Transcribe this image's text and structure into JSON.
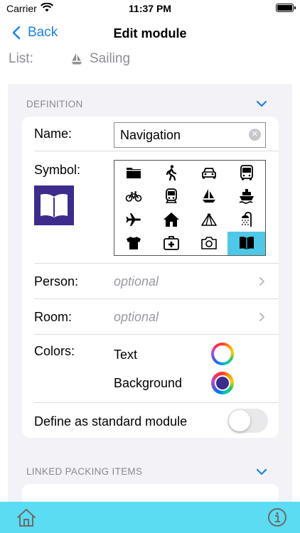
{
  "status_bar": {
    "carrier": "Carrier",
    "time": "11:37 PM"
  },
  "nav": {
    "back_label": "Back",
    "title": "Edit module"
  },
  "list_row": {
    "label": "List:",
    "value": "Sailing",
    "icon": "sailboat-icon"
  },
  "definition": {
    "header": "DEFINITION",
    "name_label": "Name:",
    "name_value": "Navigation",
    "symbol_label": "Symbol:",
    "selected_symbol": "book-icon",
    "symbols": [
      "folder-icon",
      "walking-person-icon",
      "car-icon",
      "bus-icon",
      "bicycle-icon",
      "train-icon",
      "sailboat-icon",
      "ship-icon",
      "airplane-icon",
      "house-icon",
      "tent-icon",
      "shower-icon",
      "tshirt-icon",
      "first-aid-kit-icon",
      "camera-icon",
      "book-icon"
    ],
    "person_label": "Person:",
    "person_placeholder": "optional",
    "room_label": "Room:",
    "room_placeholder": "optional",
    "colors_label": "Colors:",
    "text_color_label": "Text",
    "background_color_label": "Background",
    "background_color": "#3e2c8c",
    "text_color": "#ffffff",
    "standard_label": "Define as standard module",
    "standard_enabled": false
  },
  "linked_items": {
    "header": "LINKED PACKING ITEMS"
  },
  "tab_bar": {
    "background": "#5bdcf2",
    "icons": [
      "home-icon",
      "info-icon"
    ]
  },
  "accent_color": "#1a82e8"
}
